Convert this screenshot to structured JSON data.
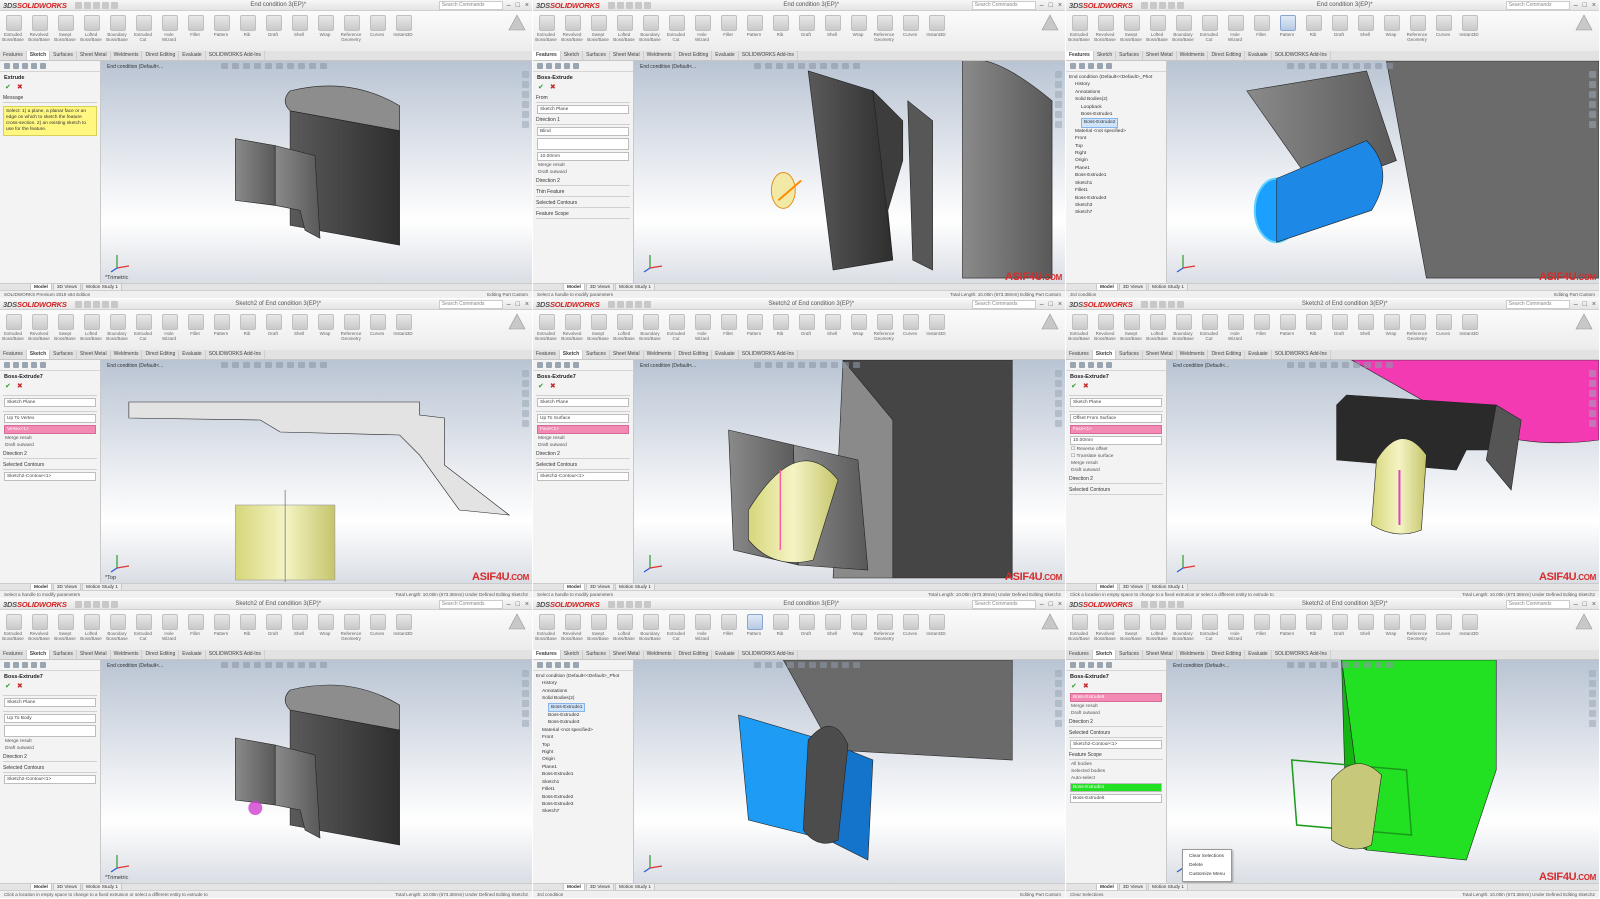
{
  "common": {
    "logo_main": "3DS",
    "logo_text": "SOLIDWORKS",
    "search_placeholder": "Search Commands",
    "watermark_main": "ASIF4U",
    "watermark_suffix": ".COM",
    "bottom_tabs": [
      "Model",
      "3D Views",
      "Motion Study 1"
    ],
    "command_tabs": [
      "Features",
      "Sketch",
      "Surfaces",
      "Sheet Metal",
      "Weldments",
      "Direct Editing",
      "Evaluate",
      "SOLIDWORKS Add-Ins"
    ],
    "ribbon_labels": [
      "Extruded Boss/Base",
      "Revolved Boss/Base",
      "Swept Boss/Base",
      "Lofted Boss/Base",
      "Boundary Boss/Base",
      "Extruded Cut",
      "Hole Wizard",
      "Fillet",
      "Pattern",
      "Rib",
      "Draft",
      "Shell",
      "Wrap",
      "Reference Geometry",
      "Curves",
      "Instant3D"
    ],
    "colors": {
      "solidworks_red": "#d32020",
      "accent_blue": "#1e90ff",
      "selection_pink": "#f28ab3",
      "feature_green": "#22e022"
    }
  },
  "panes": [
    {
      "title": "End condition 3(EP)*",
      "viewport_title": "End condition (Default<...",
      "view_label": "*Trimetric",
      "panel_title": "Extrude",
      "message_header": "Message",
      "message_text": "Select: 1) a plane, a planar face or an edge on which to sketch the feature cross-section. 2) an existing sketch to use for the feature.",
      "status_left": "SOLIDWORKS Premium 2019 x64 Edition",
      "status_right": "Editing Part    Custom",
      "show_watermark": false
    },
    {
      "title": "End condition 3(EP)*",
      "viewport_title": "End condition (Default<...",
      "view_label": "",
      "panel_title": "Boss-Extrude",
      "from_label": "From",
      "from_value": "Sketch Plane",
      "dir1_label": "Direction 1",
      "dir1_value": "Blind",
      "depth_value": "10.00mm",
      "merge_label": "Merge result",
      "draft_label": "Draft outward",
      "dir2_label": "Direction 2",
      "thin_label": "Thin Feature",
      "contours_label": "Selected Contours",
      "scope_label": "Feature Scope",
      "status_left": "Select a handle to modify parameters",
      "status_right": "Total Length: 10.00in (673.38mm)    Editing Part    Custom",
      "show_watermark": true
    },
    {
      "title": "End condition 3(EP)*",
      "viewport_title": "",
      "view_label": "",
      "panel_title": "",
      "tree": [
        "End condition  (Default<<Default>_Phot",
        "History",
        "Annotations",
        "Solid Bodies(2)",
        "Loopback",
        "Boss-Extrude1",
        "Boss-Extrude2",
        "Material <not specified>",
        "Front",
        "Top",
        "Right",
        "Origin",
        "Plane1",
        "Boss-Extrude1",
        "Sketch1",
        "Fillet1",
        "Boss-Extrude3",
        "Sketch3",
        "Sketch7"
      ],
      "status_left": "3rd condition",
      "status_right": "Editing Part    Custom",
      "show_watermark": true
    },
    {
      "title": "Sketch2 of End condition 3(EP)*",
      "viewport_title": "End condition (Default<...",
      "view_label": "*Top",
      "panel_title": "Boss-Extrude7",
      "from_value": "Sketch Plane",
      "dir1_value": "Up To Vertex",
      "selected_value": "Vertex<1>",
      "merge_label": "Merge result",
      "draft_label": "Draft outward",
      "dir2_label": "Direction 2",
      "contours_label": "Selected Contours",
      "contour_value": "Sketch2-Contour<1>",
      "status_left": "Select a handle to modify parameters",
      "status_right": "Total Length: 10.00in (673.38mm)    Under Defined    Editing Sketch2",
      "show_watermark": true
    },
    {
      "title": "Sketch2 of End condition 3(EP)*",
      "viewport_title": "End condition (Default<...",
      "view_label": "",
      "panel_title": "Boss-Extrude7",
      "from_value": "Sketch Plane",
      "dir1_value": "Up To Surface",
      "selected_value": "Face<1>",
      "merge_label": "Merge result",
      "draft_label": "Draft outward",
      "dir2_label": "Direction 2",
      "contours_label": "Selected Contours",
      "contour_value": "Sketch2-Contour<1>",
      "status_left": "Select a handle to modify parameters",
      "status_right": "Total Length: 10.00in (673.38mm)    Under Defined    Editing Sketch2",
      "show_watermark": true
    },
    {
      "title": "Sketch2 of End condition 3(EP)*",
      "viewport_title": "End condition (Default<...",
      "view_label": "",
      "panel_title": "Boss-Extrude7",
      "from_value": "Sketch Plane",
      "dir1_value": "Offset From Surface",
      "selected_value": "Face<1>",
      "depth_value": "10.00mm",
      "reverse_label": "Reverse offset",
      "translate_label": "Translate surface",
      "merge_label": "Merge result",
      "draft_label": "Draft outward",
      "dir2_label": "Direction 2",
      "contours_label": "Selected Contours",
      "status_left": "Click a location in empty space to change to a fixed extrusion or select a different entity to extrude to",
      "status_right": "Total Length: 10.00in (673.38mm)    Under Defined    Editing Sketch2",
      "show_watermark": true
    },
    {
      "title": "Sketch2 of End condition 3(EP)*",
      "viewport_title": "End condition (Default<...",
      "view_label": "*Trimetric",
      "panel_title": "Boss-Extrude7",
      "from_value": "Sketch Plane",
      "dir1_value": "Up To Body",
      "merge_label": "Merge result",
      "draft_label": "Draft outward",
      "dir2_label": "Direction 2",
      "contours_label": "Selected Contours",
      "contour_value": "Sketch2-Contour<1>",
      "status_left": "Click a location in empty space to change to a fixed extrusion or select a different entity to extrude to",
      "status_right": "Total Length: 10.00in (673.38mm)    Under Defined    Editing Sketch2",
      "show_watermark": false
    },
    {
      "title": "End condition 3(EP)*",
      "viewport_title": "",
      "view_label": "",
      "panel_title": "",
      "tree": [
        "End condition  (Default<<Default>_Phot",
        "History",
        "Annotations",
        "Solid Bodies(2)",
        "Boss-Extrude1",
        "Boss-Extrude2",
        "Boss-Extrude3",
        "Material <not specified>",
        "Front",
        "Top",
        "Right",
        "Origin",
        "Plane1",
        "Boss-Extrude1",
        "Sketch1",
        "Fillet1",
        "Boss-Extrude2",
        "Boss-Extrude3",
        "Sketch7"
      ],
      "status_left": "3rd condition",
      "status_right": "Editing Part    Custom",
      "show_watermark": false
    },
    {
      "title": "Sketch2 of End condition 3(EP)*",
      "viewport_title": "End condition (Default<...",
      "view_label": "",
      "panel_title": "Boss-Extrude7",
      "selected_value": "Boss-Extrude6",
      "merge_label": "Merge result",
      "draft_label": "Draft outward",
      "dir2_label": "Direction 2",
      "contours_label": "Selected Contours",
      "contour_value": "Sketch2-Contour<1>",
      "scope_label": "Feature Scope",
      "scope_all": "All bodies",
      "scope_selected": "Selected bodies",
      "scope_auto": "Auto-select",
      "scope_item1": "Boss-Extrude1",
      "scope_item2": "Boss-Extrude6",
      "context_menu": [
        "Clear Selections",
        "Delete",
        "Customize Menu"
      ],
      "status_left": "Clear Selections",
      "status_right": "Total Length: 10.00in (673.38mm)    Under Defined    Editing Sketch2",
      "show_watermark": true
    }
  ]
}
